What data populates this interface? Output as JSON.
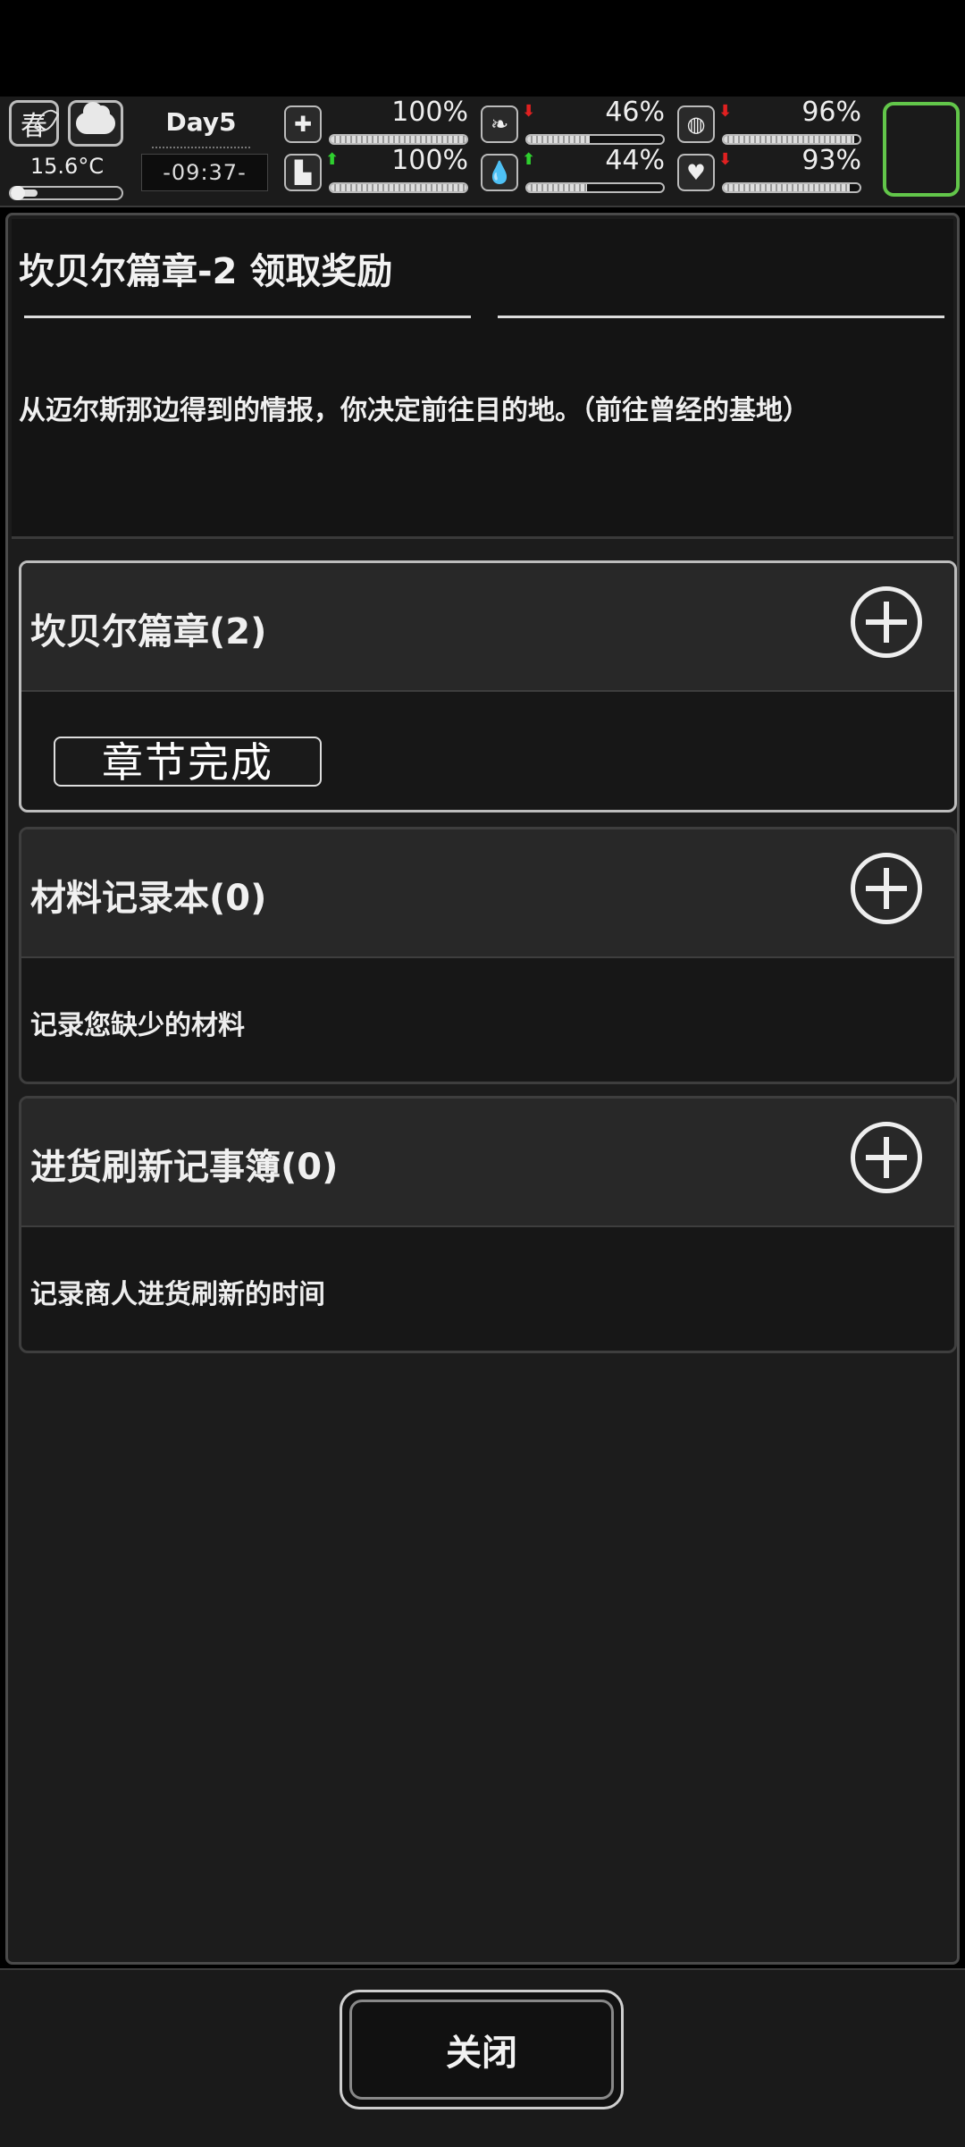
{
  "hud": {
    "season": "春",
    "temperature": "15.6°C",
    "temperature_level": 0.2,
    "day": "Day5",
    "time": "-09:37-",
    "stats": [
      {
        "name": "health",
        "icon": "medkit-icon",
        "glyph": "✚",
        "arrow": "",
        "value": "100%",
        "level": 1.0
      },
      {
        "name": "hunger",
        "icon": "stomach-icon",
        "glyph": "❧",
        "arrow": "down",
        "value": "46%",
        "level": 0.46
      },
      {
        "name": "medicine",
        "icon": "pill-icon",
        "glyph": "◍",
        "arrow": "down",
        "value": "96%",
        "level": 0.96
      },
      {
        "name": "stamina",
        "icon": "boot-icon",
        "glyph": "▙",
        "arrow": "up",
        "value": "100%",
        "level": 1.0
      },
      {
        "name": "thirst",
        "icon": "water-drop-icon",
        "glyph": "💧",
        "arrow": "up",
        "value": "44%",
        "level": 0.44
      },
      {
        "name": "mood",
        "icon": "heart-icon",
        "glyph": "♥",
        "arrow": "down",
        "value": "93%",
        "level": 0.93
      }
    ]
  },
  "quest": {
    "title": "坎贝尔篇章-2 领取奖励",
    "description": "从迈尔斯那边得到的情报，你决定前往目的地。（前往曾经的基地）"
  },
  "cards": [
    {
      "title": "坎贝尔篇章(2)",
      "badge": "章节完成",
      "body": ""
    },
    {
      "title": "材料记录本(0)",
      "badge": "",
      "body": "记录您缺少的材料"
    },
    {
      "title": "进货刷新记事簿(0)",
      "badge": "",
      "body": "记录商人进货刷新的时间"
    }
  ],
  "footer": {
    "close_label": "关闭"
  }
}
